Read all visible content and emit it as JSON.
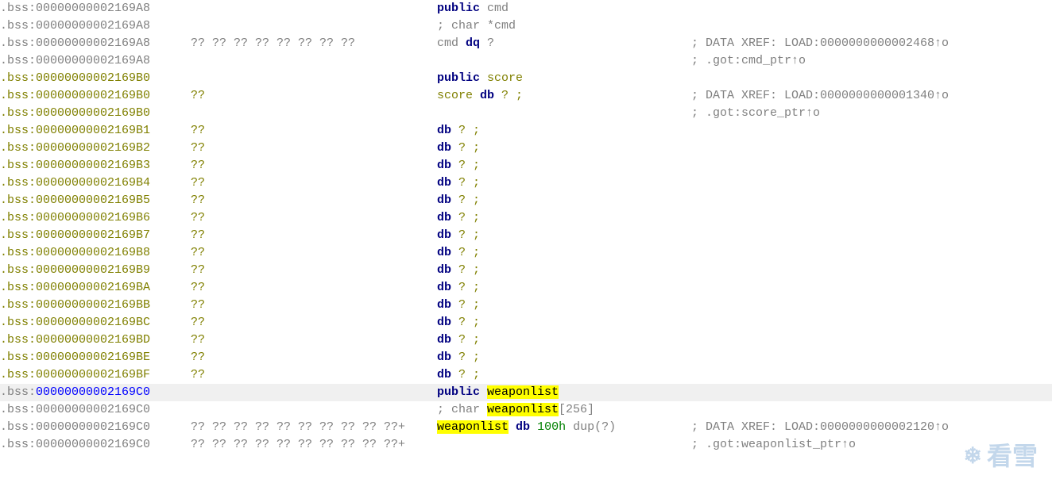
{
  "segment": ".bss",
  "lines": [
    {
      "addr": "00000000002169A8",
      "addrStyle": "addr",
      "segStyle": "seg",
      "bytes": "",
      "bytesStyle": "bytes",
      "disasm": [
        {
          "t": "public ",
          "c": "keyword"
        },
        {
          "t": "cmd",
          "c": "symbol"
        }
      ],
      "comment": ""
    },
    {
      "addr": "00000000002169A8",
      "addrStyle": "addr",
      "segStyle": "seg",
      "bytes": "",
      "bytesStyle": "bytes",
      "disasm": [
        {
          "t": "; char *cmd",
          "c": "comment"
        }
      ],
      "comment": ""
    },
    {
      "addr": "00000000002169A8",
      "addrStyle": "addr",
      "segStyle": "seg",
      "bytes": "?? ?? ?? ?? ?? ?? ?? ??",
      "bytesStyle": "bytes",
      "disasm": [
        {
          "t": "cmd ",
          "c": "symbol"
        },
        {
          "t": "dq",
          "c": "keyword"
        },
        {
          "t": " ?",
          "c": "txt"
        }
      ],
      "comment": "; DATA XREF: LOAD:0000000000002468↑o"
    },
    {
      "addr": "00000000002169A8",
      "addrStyle": "addr",
      "segStyle": "seg",
      "bytes": "",
      "bytesStyle": "bytes",
      "disasm": [],
      "comment": "; .got:cmd_ptr↑o"
    },
    {
      "addr": "00000000002169B0",
      "addrStyle": "addr-gold",
      "segStyle": "seg-gold",
      "bytes": "",
      "bytesStyle": "bytes-gold",
      "disasm": [
        {
          "t": "public ",
          "c": "keyword"
        },
        {
          "t": "score",
          "c": "sym-gold"
        }
      ],
      "comment": ""
    },
    {
      "addr": "00000000002169B0",
      "addrStyle": "addr-gold",
      "segStyle": "seg-gold",
      "bytes": "??",
      "bytesStyle": "bytes-gold",
      "disasm": [
        {
          "t": "score ",
          "c": "sym-gold"
        },
        {
          "t": "db",
          "c": "keyword"
        },
        {
          "t": "    ? ;",
          "c": "txt-gold"
        }
      ],
      "comment": "; DATA XREF: LOAD:0000000000001340↑o"
    },
    {
      "addr": "00000000002169B0",
      "addrStyle": "addr-gold",
      "segStyle": "seg-gold",
      "bytes": "",
      "bytesStyle": "bytes-gold",
      "disasm": [],
      "comment": "; .got:score_ptr↑o"
    },
    {
      "addr": "00000000002169B1",
      "addrStyle": "addr-gold",
      "segStyle": "seg-gold",
      "bytes": "??",
      "bytesStyle": "bytes-gold",
      "disasm": [
        {
          "t": "db",
          "c": "keyword"
        },
        {
          "t": "    ? ;",
          "c": "txt-gold"
        }
      ],
      "comment": ""
    },
    {
      "addr": "00000000002169B2",
      "addrStyle": "addr-gold",
      "segStyle": "seg-gold",
      "bytes": "??",
      "bytesStyle": "bytes-gold",
      "disasm": [
        {
          "t": "db",
          "c": "keyword"
        },
        {
          "t": "    ? ;",
          "c": "txt-gold"
        }
      ],
      "comment": ""
    },
    {
      "addr": "00000000002169B3",
      "addrStyle": "addr-gold",
      "segStyle": "seg-gold",
      "bytes": "??",
      "bytesStyle": "bytes-gold",
      "disasm": [
        {
          "t": "db",
          "c": "keyword"
        },
        {
          "t": "    ? ;",
          "c": "txt-gold"
        }
      ],
      "comment": ""
    },
    {
      "addr": "00000000002169B4",
      "addrStyle": "addr-gold",
      "segStyle": "seg-gold",
      "bytes": "??",
      "bytesStyle": "bytes-gold",
      "disasm": [
        {
          "t": "db",
          "c": "keyword"
        },
        {
          "t": "    ? ;",
          "c": "txt-gold"
        }
      ],
      "comment": ""
    },
    {
      "addr": "00000000002169B5",
      "addrStyle": "addr-gold",
      "segStyle": "seg-gold",
      "bytes": "??",
      "bytesStyle": "bytes-gold",
      "disasm": [
        {
          "t": "db",
          "c": "keyword"
        },
        {
          "t": "    ? ;",
          "c": "txt-gold"
        }
      ],
      "comment": ""
    },
    {
      "addr": "00000000002169B6",
      "addrStyle": "addr-gold",
      "segStyle": "seg-gold",
      "bytes": "??",
      "bytesStyle": "bytes-gold",
      "disasm": [
        {
          "t": "db",
          "c": "keyword"
        },
        {
          "t": "    ? ;",
          "c": "txt-gold"
        }
      ],
      "comment": ""
    },
    {
      "addr": "00000000002169B7",
      "addrStyle": "addr-gold",
      "segStyle": "seg-gold",
      "bytes": "??",
      "bytesStyle": "bytes-gold",
      "disasm": [
        {
          "t": "db",
          "c": "keyword"
        },
        {
          "t": "    ? ;",
          "c": "txt-gold"
        }
      ],
      "comment": ""
    },
    {
      "addr": "00000000002169B8",
      "addrStyle": "addr-gold",
      "segStyle": "seg-gold",
      "bytes": "??",
      "bytesStyle": "bytes-gold",
      "disasm": [
        {
          "t": "db",
          "c": "keyword"
        },
        {
          "t": "    ? ;",
          "c": "txt-gold"
        }
      ],
      "comment": ""
    },
    {
      "addr": "00000000002169B9",
      "addrStyle": "addr-gold",
      "segStyle": "seg-gold",
      "bytes": "??",
      "bytesStyle": "bytes-gold",
      "disasm": [
        {
          "t": "db",
          "c": "keyword"
        },
        {
          "t": "    ? ;",
          "c": "txt-gold"
        }
      ],
      "comment": ""
    },
    {
      "addr": "00000000002169BA",
      "addrStyle": "addr-gold",
      "segStyle": "seg-gold",
      "bytes": "??",
      "bytesStyle": "bytes-gold",
      "disasm": [
        {
          "t": "db",
          "c": "keyword"
        },
        {
          "t": "    ? ;",
          "c": "txt-gold"
        }
      ],
      "comment": ""
    },
    {
      "addr": "00000000002169BB",
      "addrStyle": "addr-gold",
      "segStyle": "seg-gold",
      "bytes": "??",
      "bytesStyle": "bytes-gold",
      "disasm": [
        {
          "t": "db",
          "c": "keyword"
        },
        {
          "t": "    ? ;",
          "c": "txt-gold"
        }
      ],
      "comment": ""
    },
    {
      "addr": "00000000002169BC",
      "addrStyle": "addr-gold",
      "segStyle": "seg-gold",
      "bytes": "??",
      "bytesStyle": "bytes-gold",
      "disasm": [
        {
          "t": "db",
          "c": "keyword"
        },
        {
          "t": "    ? ;",
          "c": "txt-gold"
        }
      ],
      "comment": ""
    },
    {
      "addr": "00000000002169BD",
      "addrStyle": "addr-gold",
      "segStyle": "seg-gold",
      "bytes": "??",
      "bytesStyle": "bytes-gold",
      "disasm": [
        {
          "t": "db",
          "c": "keyword"
        },
        {
          "t": "    ? ;",
          "c": "txt-gold"
        }
      ],
      "comment": ""
    },
    {
      "addr": "00000000002169BE",
      "addrStyle": "addr-gold",
      "segStyle": "seg-gold",
      "bytes": "??",
      "bytesStyle": "bytes-gold",
      "disasm": [
        {
          "t": "db",
          "c": "keyword"
        },
        {
          "t": "    ? ;",
          "c": "txt-gold"
        }
      ],
      "comment": ""
    },
    {
      "addr": "00000000002169BF",
      "addrStyle": "addr-gold",
      "segStyle": "seg-gold",
      "bytes": "??",
      "bytesStyle": "bytes-gold",
      "disasm": [
        {
          "t": "db",
          "c": "keyword"
        },
        {
          "t": "    ? ;",
          "c": "txt-gold"
        }
      ],
      "comment": ""
    },
    {
      "addr": "00000000002169C0",
      "addrStyle": "addr-blue",
      "segStyle": "seg",
      "bytes": "",
      "bytesStyle": "bytes",
      "highlight": true,
      "disasm": [
        {
          "t": "public ",
          "c": "keyword"
        },
        {
          "t": "weaponlist",
          "c": "symbol",
          "hl": true
        }
      ],
      "comment": ""
    },
    {
      "addr": "00000000002169C0",
      "addrStyle": "addr",
      "segStyle": "seg",
      "bytes": "",
      "bytesStyle": "bytes",
      "disasm": [
        {
          "t": "; char ",
          "c": "comment"
        },
        {
          "t": "weaponlist",
          "c": "comment",
          "hl": true
        },
        {
          "t": "[256]",
          "c": "comment"
        }
      ],
      "comment": ""
    },
    {
      "addr": "00000000002169C0",
      "addrStyle": "addr",
      "segStyle": "seg",
      "bytes": "?? ?? ?? ?? ?? ?? ?? ?? ?? ??+",
      "bytesStyle": "bytes",
      "disasm": [
        {
          "t": "weaponlist",
          "c": "symbol",
          "hl": true
        },
        {
          "t": " ",
          "c": "txt"
        },
        {
          "t": "db",
          "c": "keyword"
        },
        {
          "t": " ",
          "c": "txt"
        },
        {
          "t": "100h",
          "c": "num"
        },
        {
          "t": " dup(?)",
          "c": "txt"
        }
      ],
      "comment": "; DATA XREF: LOAD:0000000000002120↑o"
    },
    {
      "addr": "00000000002169C0",
      "addrStyle": "addr",
      "segStyle": "seg",
      "bytes": "?? ?? ?? ?? ?? ?? ?? ?? ?? ??+",
      "bytesStyle": "bytes",
      "disasm": [],
      "comment": "; .got:weaponlist_ptr↑o"
    }
  ],
  "watermark": "看雪"
}
